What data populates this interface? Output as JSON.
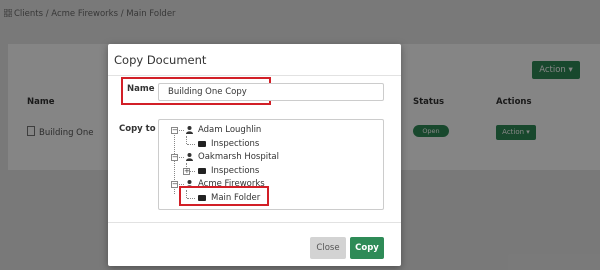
{
  "breadcrumb": {
    "text": "Clients / Acme Fireworks / Main Folder"
  },
  "background": {
    "action_button": "Action ▾",
    "columns": {
      "name": "Name",
      "status": "Status",
      "actions": "Actions"
    },
    "row": {
      "name": "Building One",
      "status": "Open",
      "action": "Action ▾"
    }
  },
  "modal": {
    "title": "Copy Document",
    "name_label": "Name",
    "name_value": "Building One Copy",
    "copy_to_label": "Copy to",
    "tree": [
      {
        "label": "Adam Loughlin",
        "icon": "person-icon"
      },
      {
        "label": "Inspections",
        "icon": "folder-icon"
      },
      {
        "label": "Oakmarsh Hospital",
        "icon": "person-icon"
      },
      {
        "label": "Inspections",
        "icon": "folder-icon"
      },
      {
        "label": "Acme Fireworks",
        "icon": "person-icon"
      },
      {
        "label": "Main Folder",
        "icon": "folder-icon"
      }
    ],
    "close_label": "Close",
    "copy_label": "Copy"
  },
  "colors": {
    "primary": "#2e8b57",
    "highlight": "#d21f27"
  }
}
